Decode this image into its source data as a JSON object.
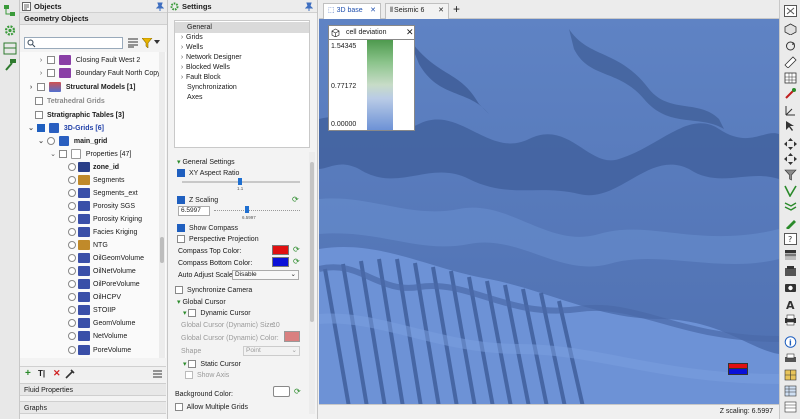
{
  "objects_panel": {
    "title": "Objects",
    "subtitle": "Geometry Objects",
    "search_placeholder": "",
    "tree": [
      {
        "label": "Closing Fault West 2"
      },
      {
        "label": "Boundary Fault North Copy1"
      },
      {
        "label": "Structural Models [1]"
      },
      {
        "label": "Tetrahedral Grids"
      },
      {
        "label": "Stratigraphic Tables [3]"
      },
      {
        "label": "3D-Grids [6]"
      },
      {
        "label": "main_grid"
      },
      {
        "label": "Properties [47]"
      },
      {
        "label": "zone_id"
      },
      {
        "label": "Segments"
      },
      {
        "label": "Segments_ext"
      },
      {
        "label": "Porosity SGS"
      },
      {
        "label": "Porosity Kriging"
      },
      {
        "label": "Facies Kriging"
      },
      {
        "label": "NTG"
      },
      {
        "label": "OilGeomVolume"
      },
      {
        "label": "OilNetVolume"
      },
      {
        "label": "OilPoreVolume"
      },
      {
        "label": "OilHCPV"
      },
      {
        "label": "STOIIP"
      },
      {
        "label": "GeomVolume"
      },
      {
        "label": "NetVolume"
      },
      {
        "label": "PoreVolume"
      }
    ],
    "bottom_sections": [
      "Fluid Properties",
      "Graphs"
    ]
  },
  "settings_panel": {
    "title": "Settings",
    "categories": [
      "General",
      "Grids",
      "Wells",
      "Network Designer",
      "Blocked Wells",
      "Fault Block",
      "Synchronization",
      "Axes"
    ],
    "general_settings_header": "General Settings",
    "xy_aspect_ratio_label": "XY Aspect Ratio",
    "xy_slider_value": "1.1",
    "z_scaling_label": "Z Scaling",
    "z_scaling_value": "6.5997",
    "z_slider_value": "6.5997",
    "show_compass_label": "Show Compass",
    "perspective_label": "Perspective Projection",
    "compass_top_label": "Compass Top Color:",
    "compass_bottom_label": "Compass Bottom Color:",
    "auto_adjust_label": "Auto Adjust Scale",
    "auto_adjust_value": "Disable",
    "sync_camera_label": "Synchronize Camera",
    "global_cursor_label": "Global Cursor",
    "dynamic_cursor_label": "Dynamic Cursor",
    "dyn_size_label": "Global Cursor (Dynamic) Size:",
    "dyn_size_value": "10",
    "dyn_color_label": "Global Cursor (Dynamic) Color:",
    "shape_label": "Shape",
    "shape_value": "Point",
    "static_cursor_label": "Static Cursor",
    "show_axis_label": "Show Axis",
    "background_color_label": "Background Color:",
    "allow_multiple_grids_label": "Allow Multiple Grids",
    "compass_top_color": "#e01010",
    "compass_bottom_color": "#0a10d8"
  },
  "tabs": [
    {
      "label": "3D base",
      "active": true
    },
    {
      "label": "Seismic 6",
      "active": false
    }
  ],
  "legend": {
    "title": "cell deviation",
    "max": "1.54345",
    "mid": "0.77172",
    "min": "0.00000"
  },
  "status": {
    "z_scaling": "Z scaling: 6.5997"
  },
  "colors": {
    "surface": "#5d7fbf",
    "accent": "#1f5fbf"
  }
}
